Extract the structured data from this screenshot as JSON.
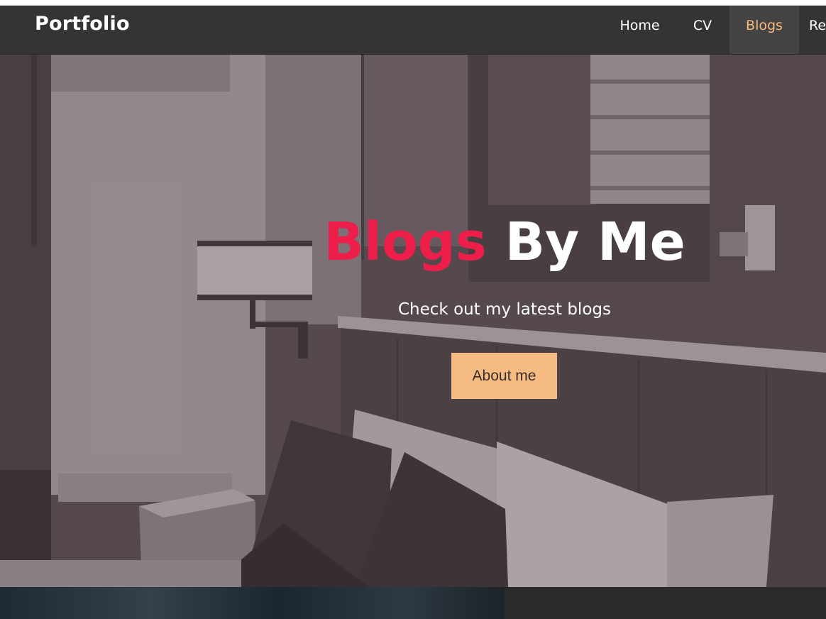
{
  "navbar": {
    "brand": "Portfolio",
    "items": [
      {
        "label": "Home",
        "active": false
      },
      {
        "label": "CV",
        "active": false
      },
      {
        "label": "Blogs",
        "active": true
      },
      {
        "label": "Re",
        "active": false
      }
    ]
  },
  "hero": {
    "title_accent": "Blogs",
    "title_rest": "By Me",
    "subtitle": "Check out my latest blogs",
    "button_label": "About me"
  },
  "colors": {
    "accent_red": "#ed1f4a",
    "button_peach": "#f5bb80",
    "nav_active_text": "#f5b97c",
    "navbar_bg": "#353435"
  }
}
